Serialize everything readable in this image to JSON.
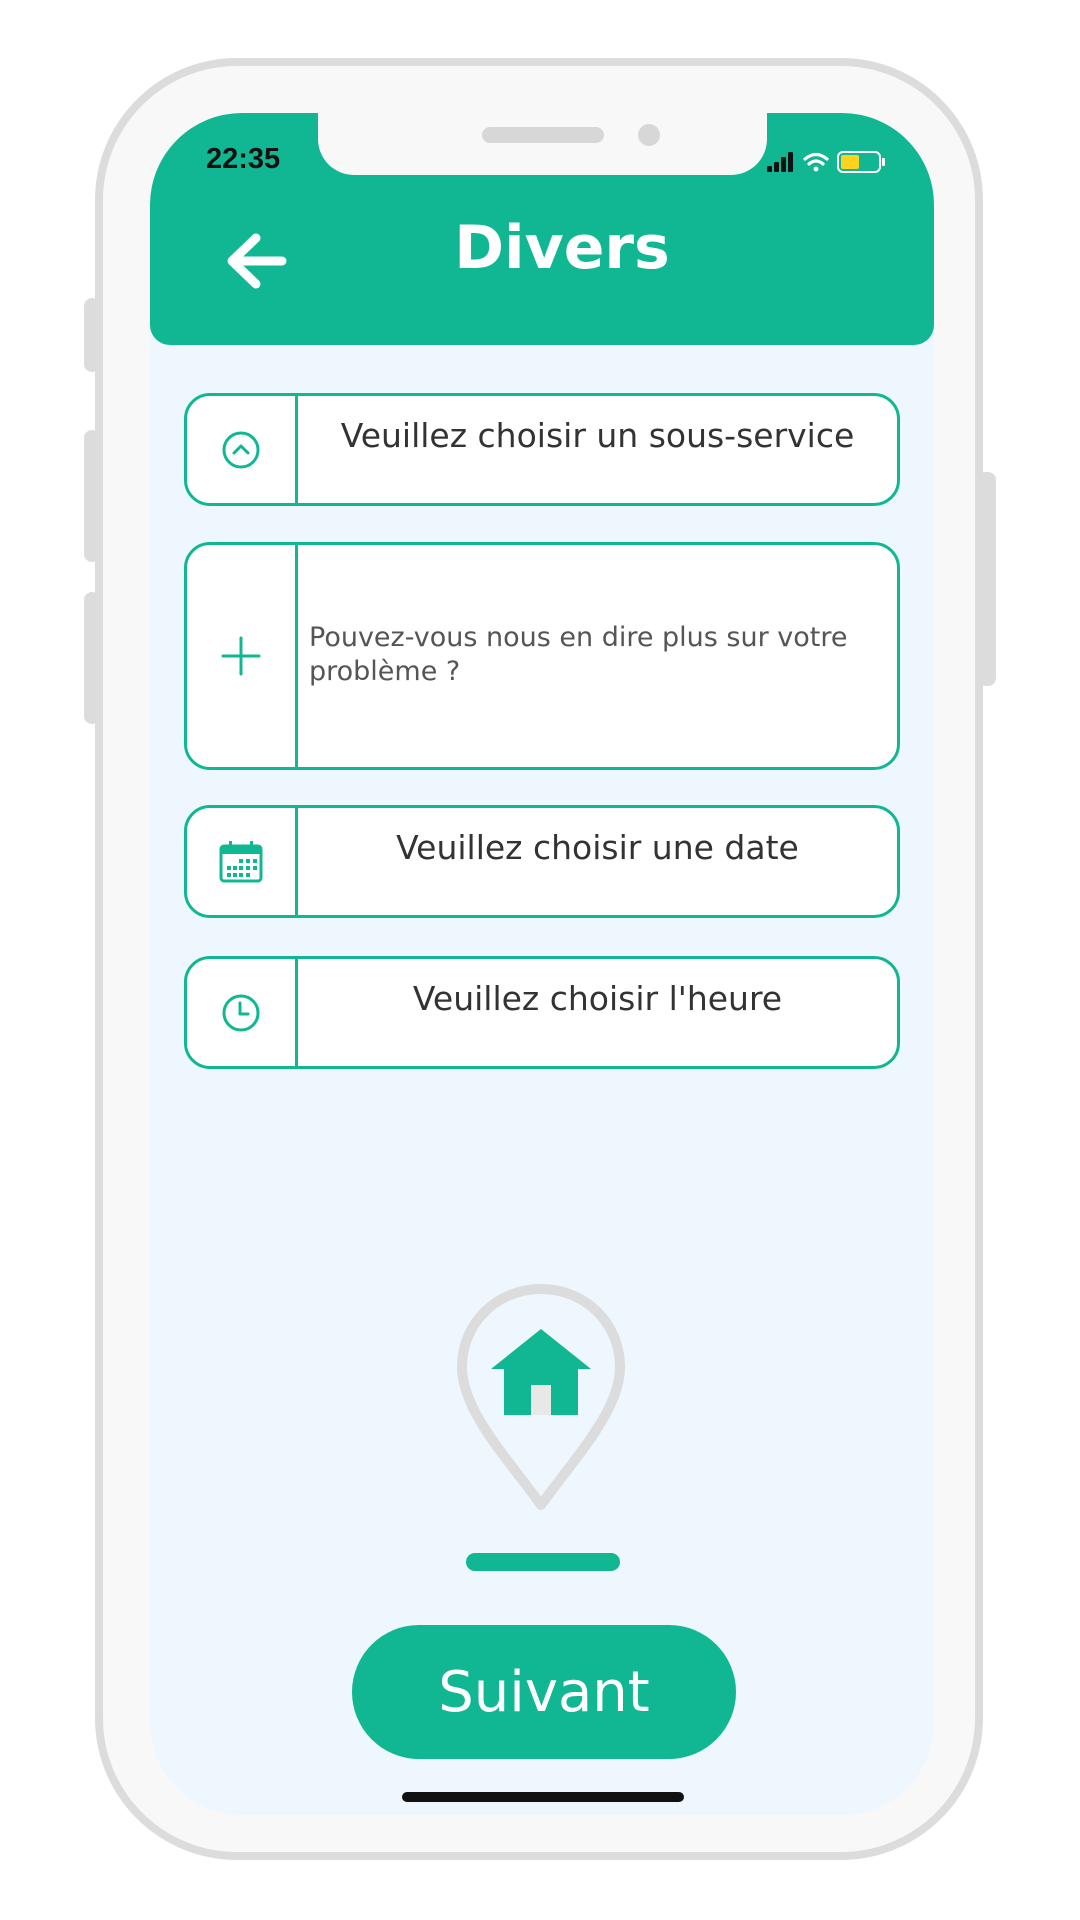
{
  "status_bar": {
    "time": "22:35",
    "icons": [
      "signal-icon",
      "wifi-icon",
      "battery-icon"
    ]
  },
  "header": {
    "title": "Divers",
    "back_icon": "arrow-left-icon"
  },
  "form": {
    "sub_service": {
      "label": "Veuillez choisir un sous-service",
      "icon": "chevron-up-circle-icon"
    },
    "description": {
      "placeholder": "Pouvez-vous nous en dire plus sur votre problème ?",
      "value": "",
      "icon": "plus-icon"
    },
    "date": {
      "label": "Veuillez choisir une date",
      "icon": "calendar-icon"
    },
    "time": {
      "label": "Veuillez choisir l'heure",
      "icon": "clock-icon"
    }
  },
  "illustration": {
    "icon": "home-location-pin-icon"
  },
  "actions": {
    "next_label": "Suivant"
  },
  "colors": {
    "accent": "#10b792",
    "screen_background": "#eef6fe",
    "field_background": "#ffffff",
    "text": "#333333",
    "battery": "#ffd21f"
  }
}
